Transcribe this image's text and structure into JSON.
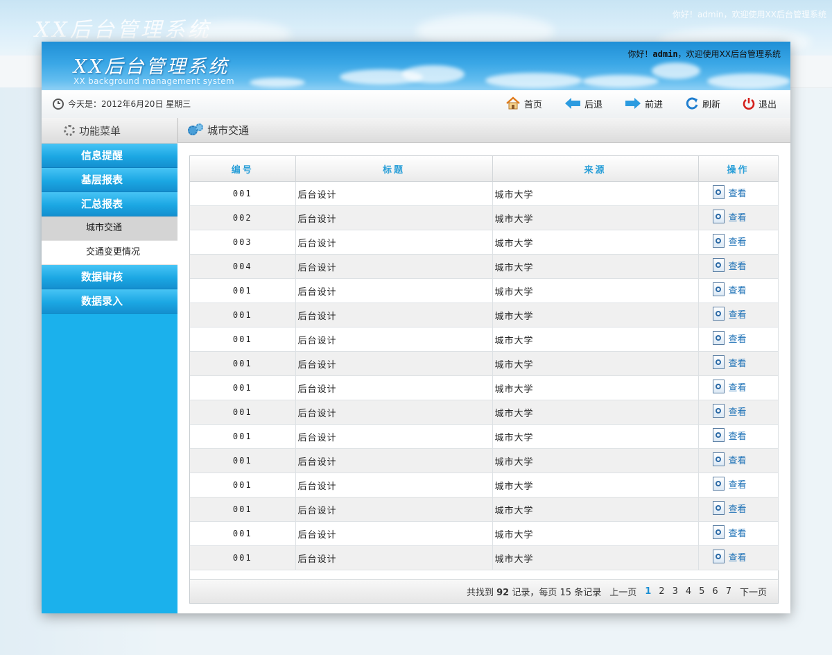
{
  "app": {
    "title": "XX后台管理系统",
    "subtitle": "XX background management system",
    "greeting_prefix": "你好！",
    "user": "admin",
    "greeting_suffix": "，欢迎使用XX后台管理系统"
  },
  "toolbar": {
    "date_text": "今天是：2012年6月20日  星期三",
    "nav": [
      {
        "label": "首页",
        "icon": "home-icon"
      },
      {
        "label": "后退",
        "icon": "arrow-left-icon"
      },
      {
        "label": "前进",
        "icon": "arrow-right-icon"
      },
      {
        "label": "刷新",
        "icon": "refresh-icon"
      },
      {
        "label": "退出",
        "icon": "power-icon"
      }
    ]
  },
  "sidebar": {
    "heading": "功能菜单",
    "categories": [
      {
        "label": "信息提醒"
      },
      {
        "label": "基层报表"
      },
      {
        "label": "汇总报表"
      }
    ],
    "sub_items": [
      {
        "label": "城市交通",
        "active": true
      },
      {
        "label": "交通变更情况",
        "active": false
      }
    ],
    "categories_after": [
      {
        "label": "数据审核"
      },
      {
        "label": "数据录入"
      }
    ]
  },
  "content": {
    "heading": "城市交通",
    "columns": [
      "编号",
      "标题",
      "来源",
      "操作"
    ],
    "rows": [
      {
        "id": "001",
        "title": "后台设计",
        "source": "城市大学",
        "action": "查看"
      },
      {
        "id": "002",
        "title": "后台设计",
        "source": "城市大学",
        "action": "查看"
      },
      {
        "id": "003",
        "title": "后台设计",
        "source": "城市大学",
        "action": "查看"
      },
      {
        "id": "004",
        "title": "后台设计",
        "source": "城市大学",
        "action": "查看"
      },
      {
        "id": "001",
        "title": "后台设计",
        "source": "城市大学",
        "action": "查看"
      },
      {
        "id": "001",
        "title": "后台设计",
        "source": "城市大学",
        "action": "查看"
      },
      {
        "id": "001",
        "title": "后台设计",
        "source": "城市大学",
        "action": "查看"
      },
      {
        "id": "001",
        "title": "后台设计",
        "source": "城市大学",
        "action": "查看"
      },
      {
        "id": "001",
        "title": "后台设计",
        "source": "城市大学",
        "action": "查看"
      },
      {
        "id": "001",
        "title": "后台设计",
        "source": "城市大学",
        "action": "查看"
      },
      {
        "id": "001",
        "title": "后台设计",
        "source": "城市大学",
        "action": "查看"
      },
      {
        "id": "001",
        "title": "后台设计",
        "source": "城市大学",
        "action": "查看"
      },
      {
        "id": "001",
        "title": "后台设计",
        "source": "城市大学",
        "action": "查看"
      },
      {
        "id": "001",
        "title": "后台设计",
        "source": "城市大学",
        "action": "查看"
      },
      {
        "id": "001",
        "title": "后台设计",
        "source": "城市大学",
        "action": "查看"
      },
      {
        "id": "001",
        "title": "后台设计",
        "source": "城市大学",
        "action": "查看"
      }
    ],
    "pager": {
      "found_prefix": "共找到",
      "total": "92",
      "found_mid": "记录，每页",
      "per_page": "15",
      "found_suffix": "条记录",
      "prev": "上一页",
      "pages": [
        "1",
        "2",
        "3",
        "4",
        "5",
        "6",
        "7"
      ],
      "current": "1",
      "next": "下一页"
    }
  },
  "colors": {
    "accent": "#1bb1ec",
    "header_blue": "#2a9fd8",
    "link": "#1a6fb5"
  }
}
